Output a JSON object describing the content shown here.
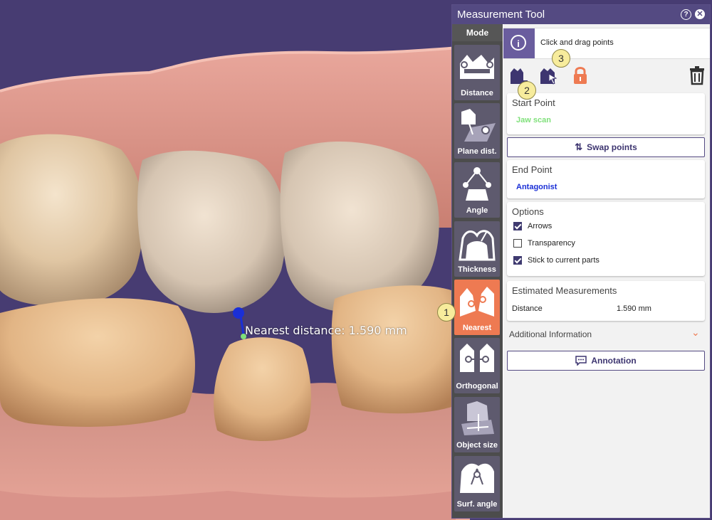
{
  "scene": {
    "measurement_label": "Nearest distance: 1.590 mm"
  },
  "callouts": [
    "1",
    "2",
    "3"
  ],
  "panel": {
    "title": "Measurement Tool",
    "help_icon": "?",
    "close_icon": "✕",
    "mode_header": "Mode",
    "modes": [
      {
        "label": "Distance",
        "icon": "distance-icon",
        "active": false
      },
      {
        "label": "Plane dist.",
        "icon": "plane-distance-icon",
        "active": false
      },
      {
        "label": "Angle",
        "icon": "angle-icon",
        "active": false
      },
      {
        "label": "Thickness",
        "icon": "thickness-icon",
        "active": false
      },
      {
        "label": "Nearest",
        "icon": "nearest-icon",
        "active": true
      },
      {
        "label": "Orthogonal",
        "icon": "orthogonal-icon",
        "active": false
      },
      {
        "label": "Object size",
        "icon": "object-size-icon",
        "active": false
      },
      {
        "label": "Surf. angle",
        "icon": "surface-angle-icon",
        "active": false
      }
    ],
    "info_icon": "i",
    "info_text": "Click and drag points",
    "tools": [
      "select-part-icon",
      "pick-point-icon",
      "lock-icon",
      "trash-icon"
    ],
    "start_point": {
      "header": "Start Point",
      "value": "Jaw scan",
      "color": "#7fe07a"
    },
    "swap_button": "Swap points",
    "end_point": {
      "header": "End Point",
      "value": "Antagonist",
      "color": "#1a2fd6"
    },
    "options": {
      "header": "Options",
      "items": [
        {
          "label": "Arrows",
          "checked": true
        },
        {
          "label": "Transparency",
          "checked": false
        },
        {
          "label": "Stick to current parts",
          "checked": true
        }
      ]
    },
    "estimated": {
      "header": "Estimated Measurements",
      "name": "Distance",
      "value": "1.590 mm"
    },
    "additional": {
      "label": "Additional Information",
      "chevron": "⌄"
    },
    "annotation_button": "Annotation",
    "colors": {
      "accent": "#ee7a52",
      "header": "#544a82",
      "background": "#473c72"
    }
  }
}
